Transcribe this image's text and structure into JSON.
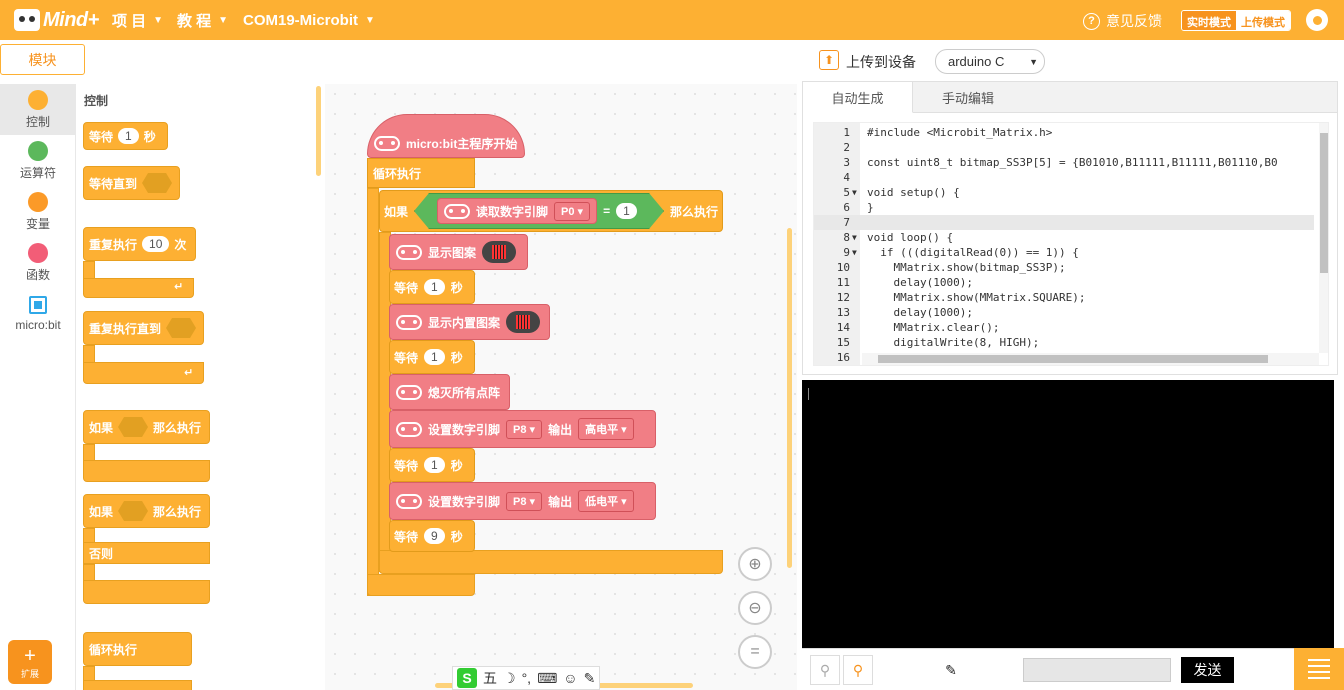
{
  "topbar": {
    "logo_text": "Mind+",
    "menu_project": "项 目",
    "menu_tutorial": "教 程",
    "menu_port": "COM19-Microbit",
    "feedback": "意见反馈",
    "mode_realtime": "实时模式",
    "mode_upload": "上传模式"
  },
  "left": {
    "modules_tab": "模块",
    "categories": [
      {
        "label": "控制",
        "color": "#FDB033"
      },
      {
        "label": "运算符",
        "color": "#5CB85C"
      },
      {
        "label": "变量",
        "color": "#FB9A28"
      },
      {
        "label": "函数",
        "color": "#F25D77"
      },
      {
        "label": "micro:bit",
        "color": "#2FA8E8"
      }
    ],
    "extension_label": "扩展"
  },
  "palette": {
    "title": "控制",
    "wait": "等待",
    "wait_value": "1",
    "seconds": "秒",
    "wait_until": "等待直到",
    "repeat": "重复执行",
    "repeat_value": "10",
    "times": "次",
    "repeat_until": "重复执行直到",
    "if": "如果",
    "then": "那么执行",
    "if2": "如果",
    "then2": "那么执行",
    "else": "否则",
    "forever": "循环执行"
  },
  "workspace": {
    "start": "micro:bit主程序开始",
    "forever": "循环执行",
    "if": "如果",
    "read_pin": "读取数字引脚",
    "pin_p0": "P0",
    "eq": "=",
    "eq_value": "1",
    "then": "那么执行",
    "show_pattern": "显示图案",
    "wait": "等待",
    "sec": "秒",
    "w1": "1",
    "w2": "1",
    "w3": "1",
    "w4": "9",
    "show_builtin": "显示内置图案",
    "clear": "熄灭所有点阵",
    "set_pin": "设置数字引脚",
    "pin_p8": "P8",
    "output": "输出",
    "high": "高电平",
    "low": "低电平"
  },
  "upload": {
    "label": "上传到设备",
    "board": "arduino C"
  },
  "code": {
    "tab_auto": "自动生成",
    "tab_manual": "手动编辑",
    "lines": [
      "#include <Microbit_Matrix.h>",
      "",
      "const uint8_t bitmap_SS3P[5] = {B01010,B11111,B11111,B01110,B0",
      "",
      "void setup() {",
      "}",
      "",
      "void loop() {",
      "  if (((digitalRead(0)) == 1)) {",
      "    MMatrix.show(bitmap_SS3P);",
      "    delay(1000);",
      "    MMatrix.show(MMatrix.SQUARE);",
      "    delay(1000);",
      "    MMatrix.clear();",
      "    digitalWrite(8, HIGH);",
      ""
    ]
  },
  "serial": {
    "send": "发送"
  },
  "ime": {
    "logo": "S",
    "mode": "五"
  }
}
